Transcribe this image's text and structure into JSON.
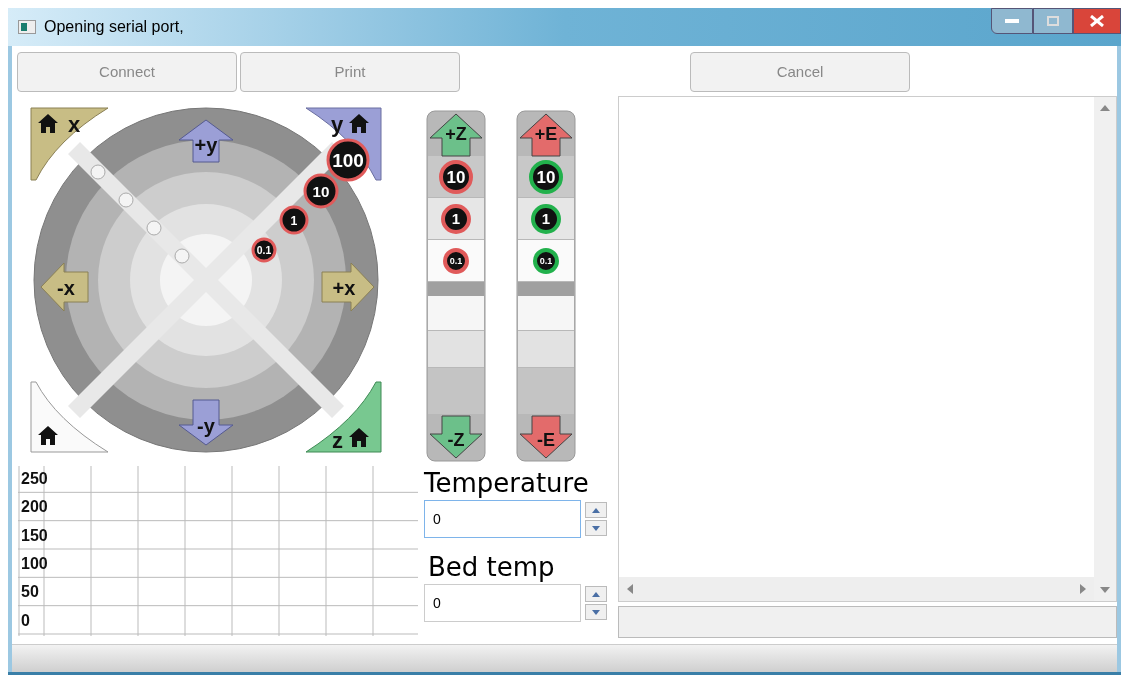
{
  "window": {
    "title": "Opening serial port,"
  },
  "toolbar": [
    {
      "label": "Connect",
      "disabled": true
    },
    {
      "label": "Print",
      "disabled": true
    },
    {
      "label": "Cancel",
      "disabled": true
    }
  ],
  "xy_jog": {
    "home_x": "x",
    "home_y": "y",
    "home_z": "z",
    "plus_y": "+y",
    "minus_y": "-y",
    "minus_x": "-x",
    "plus_x": "+x",
    "steps": [
      {
        "label": "100"
      },
      {
        "label": "10"
      },
      {
        "label": "1"
      },
      {
        "label": "0.1"
      }
    ]
  },
  "axis_bars": [
    {
      "plus": "+Z",
      "minus": "-Z",
      "color": "#6cc08a",
      "steps": [
        {
          "label": "10",
          "color": "#e05a5a"
        },
        {
          "label": "1",
          "color": "#e05a5a"
        },
        {
          "label": "0.1",
          "color": "#e05a5a"
        }
      ]
    },
    {
      "plus": "+E",
      "minus": "-E",
      "color": "#e36b6b",
      "steps": [
        {
          "label": "10",
          "color": "#22b14c"
        },
        {
          "label": "1",
          "color": "#22b14c"
        },
        {
          "label": "0.1",
          "color": "#22b14c"
        }
      ]
    }
  ],
  "graph": {
    "y_labels": [
      "250",
      "200",
      "150",
      "100",
      "50",
      "0"
    ]
  },
  "temperature": {
    "label": "Temperature",
    "value": "0"
  },
  "bed_temp": {
    "label": "Bed temp",
    "value": "0"
  }
}
